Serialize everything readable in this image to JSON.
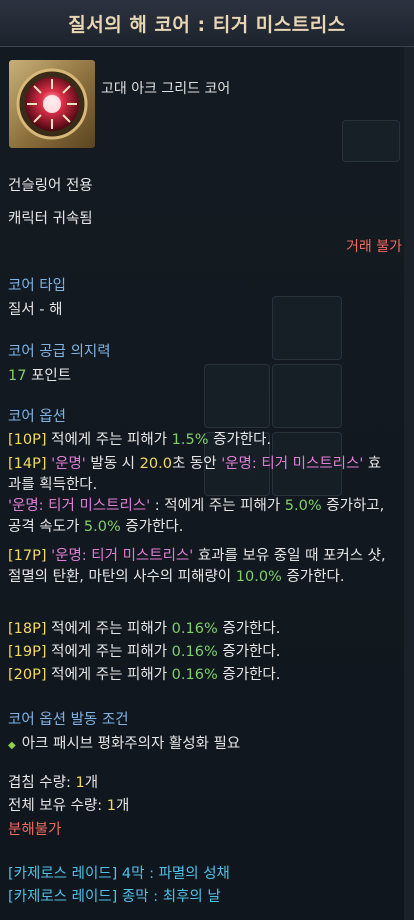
{
  "title": "질서의 해 코어 : 티거 미스트리스",
  "item_type": "고대 아크 그리드 코어",
  "class_restriction": "건슬링어 전용",
  "bound": "캐릭터 귀속됨",
  "trade": "거래 불가",
  "core_type": {
    "header": "코어 타입",
    "value": "질서 - 해"
  },
  "supply": {
    "header": "코어 공급 의지력",
    "value": "17",
    "unit": "포인트"
  },
  "options": {
    "header": "코어 옵션",
    "o10": {
      "tag": "[10P]",
      "t1": " 적에게 주는 피해가 ",
      "v": "1.5%",
      "t2": " 증가한다."
    },
    "o14": {
      "tag": "[14P]",
      "name1": " '운명'",
      "t1": " 발동 시 ",
      "v": "20.0",
      "t2": "초 동안 ",
      "name2": "'운명: 티거 미스트리스'",
      "t3": " 효과를 획득한다.",
      "name3": "'운명: 티거 미스트리스'",
      "t4": " : 적에게 주는 피해가 ",
      "v2": "5.0%",
      "t5": " 증가하고, 공격 속도가 ",
      "v3": "5.0%",
      "t6": " 증가한다."
    },
    "o17": {
      "tag": "[17P]",
      "name": " '운명: 티거 미스트리스'",
      "t1": " 효과를 보유 중일 때 포커스 샷, 절멸의 탄환, 마탄의 사수의 피해량이 ",
      "v": "10.0%",
      "t2": " 증가한다."
    },
    "o18": {
      "tag": "[18P]",
      "t1": " 적에게 주는 피해가 ",
      "v": "0.16%",
      "t2": " 증가한다."
    },
    "o19": {
      "tag": "[19P]",
      "t1": " 적에게 주는 피해가 ",
      "v": "0.16%",
      "t2": " 증가한다."
    },
    "o20": {
      "tag": "[20P]",
      "t1": " 적에게 주는 피해가 ",
      "v": "0.16%",
      "t2": " 증가한다."
    }
  },
  "condition": {
    "header": "코어 옵션 발동 조건",
    "text": "아크 패시브 평화주의자 활성화 필요"
  },
  "stack": {
    "label": "겹침 수량: ",
    "value": "1",
    "unit": "개"
  },
  "owned": {
    "label": "전체 보유 수량: ",
    "value": "1",
    "unit": "개"
  },
  "disassemble": "분해불가",
  "sources": [
    "[카제로스 레이드] 4막 : 파멸의 성채",
    "[카제로스 레이드] 종막 : 최후의 날"
  ]
}
